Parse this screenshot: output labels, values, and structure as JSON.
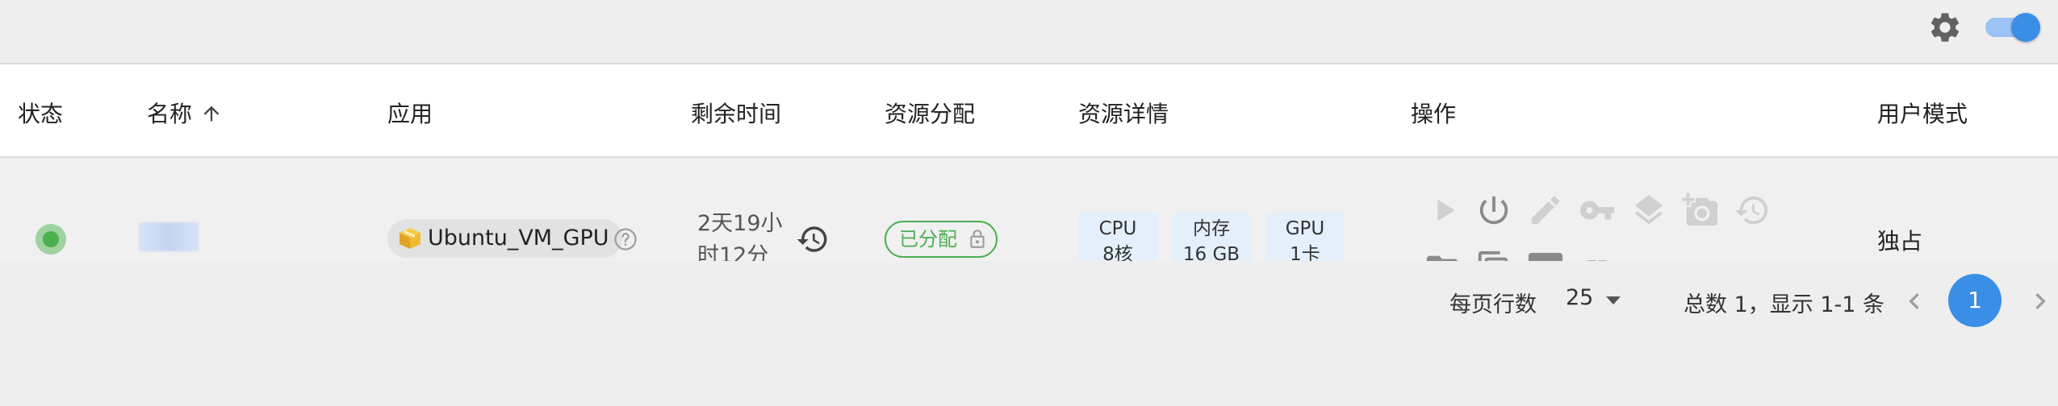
{
  "columns": {
    "status": "状态",
    "name": "名称",
    "app": "应用",
    "remaining": "剩余时间",
    "allocation": "资源分配",
    "details": "资源详情",
    "actions": "操作",
    "user_mode": "用户模式"
  },
  "row": {
    "status": "running",
    "app_name": "Ubuntu_VM_GPU",
    "remaining_time": "2天19小时12分",
    "allocation_label": "已分配",
    "resources": [
      {
        "label": "CPU",
        "value": "8核"
      },
      {
        "label": "内存",
        "value": "16 GB"
      },
      {
        "label": "GPU",
        "value": "1卡"
      }
    ],
    "user_mode": "独占"
  },
  "pagination": {
    "rows_per_page_label": "每页行数",
    "rows_per_page": "25",
    "summary": "总数 1，显示  1-1 条",
    "current_page": "1"
  },
  "colors": {
    "accent": "#3a8ee6",
    "status_green": "#4caf50",
    "chip_bg": "#e3effb",
    "icon_gray": "#9e9e9e"
  },
  "settings": {
    "toggle_on": true
  }
}
